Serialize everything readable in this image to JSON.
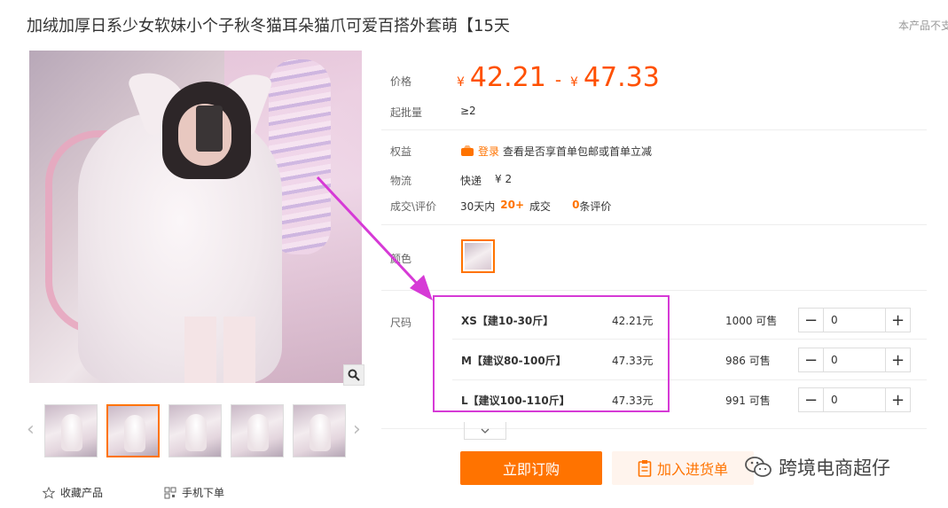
{
  "header": {
    "title": "加绒加厚日系少女软妹小个子秋冬猫耳朵猫爪可爱百搭外套萌【15天",
    "note": "本产品不支"
  },
  "gallery": {
    "fav_label": "收藏产品",
    "mobile_label": "手机下单",
    "thumb_count": 5,
    "active_index": 1
  },
  "labels": {
    "price": "价格",
    "min_order": "起批量",
    "rights": "权益",
    "logistics": "物流",
    "deals": "成交\\评价",
    "color": "颜色",
    "size": "尺码"
  },
  "price": {
    "currency": "¥",
    "low": "42.21",
    "dash": "-",
    "high": "47.33"
  },
  "min_order": "≥2",
  "rights": {
    "login": "登录",
    "text": "查看是否享首单包邮或首单立减"
  },
  "logistics": {
    "method": "快递",
    "fee": "¥ 2"
  },
  "deals": {
    "prefix": "30天内",
    "count": "20+",
    "suffix": "成交",
    "reviews": "0",
    "reviews_suffix": "条评价"
  },
  "sizes": [
    {
      "name": "XS【建10-30斤】",
      "price": "42.21元",
      "stock": "1000 可售",
      "qty": "0"
    },
    {
      "name": "M【建议80-100斤】",
      "price": "47.33元",
      "stock": "986 可售",
      "qty": "0"
    },
    {
      "name": "L【建议100-110斤】",
      "price": "47.33元",
      "stock": "991 可售",
      "qty": "0"
    }
  ],
  "buttons": {
    "order": "立即订购",
    "cart": "加入进货单",
    "minus": "−",
    "plus": "+"
  },
  "watermark": "跨境电商超仔",
  "colors": {
    "accent": "#ff7300",
    "price": "#ff5000",
    "annotation": "#d63ad6"
  }
}
